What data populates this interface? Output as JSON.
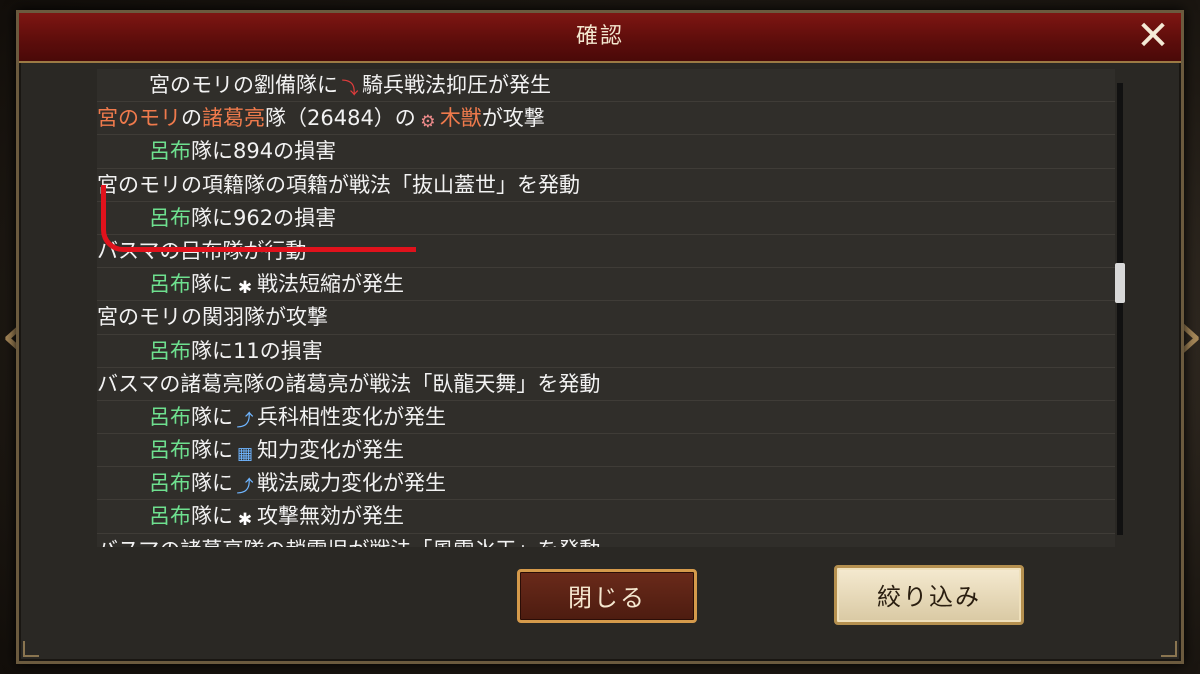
{
  "dialog": {
    "title": "確認",
    "close_glyph": "✕"
  },
  "log": [
    {
      "indent": true,
      "segments": [
        {
          "t": "宮のモリの劉備隊に"
        },
        {
          "icon": "spiral-down-icon",
          "glyph": "⤵",
          "color": "red"
        },
        {
          "t": "騎兵戦法抑圧が発生"
        }
      ]
    },
    {
      "indent": false,
      "segments": [
        {
          "t": "宮のモリ",
          "c": "orange"
        },
        {
          "t": "の"
        },
        {
          "t": "諸葛亮",
          "c": "orange"
        },
        {
          "t": "隊（26484）の"
        },
        {
          "icon": "wooden-beast-icon",
          "glyph": "⚙",
          "color": "pink"
        },
        {
          "t": "木獣",
          "c": "orange"
        },
        {
          "t": "が攻撃"
        }
      ]
    },
    {
      "indent": true,
      "segments": [
        {
          "t": "呂布",
          "c": "green"
        },
        {
          "t": "隊に894の損害"
        }
      ]
    },
    {
      "indent": false,
      "segments": [
        {
          "t": "宮のモリの項籍隊の項籍が戦法「抜山蓋世」を発動"
        }
      ]
    },
    {
      "indent": true,
      "segments": [
        {
          "t": "呂布",
          "c": "green"
        },
        {
          "t": "隊に962の損害"
        }
      ]
    },
    {
      "indent": false,
      "segments": [
        {
          "t": "バスマの呂布隊が行動"
        }
      ]
    },
    {
      "indent": true,
      "segments": [
        {
          "t": "呂布",
          "c": "green"
        },
        {
          "t": "隊に"
        },
        {
          "icon": "tactic-shorten-icon",
          "glyph": "✱",
          "color": "white"
        },
        {
          "t": "戦法短縮が発生"
        }
      ]
    },
    {
      "indent": false,
      "segments": [
        {
          "t": "宮のモリの関羽隊が攻撃"
        }
      ]
    },
    {
      "indent": true,
      "segments": [
        {
          "t": "呂布",
          "c": "green"
        },
        {
          "t": "隊に11の損害"
        }
      ]
    },
    {
      "indent": false,
      "segments": [
        {
          "t": "バスマの諸葛亮隊の諸葛亮が戦法「臥龍天舞」を発動"
        }
      ]
    },
    {
      "indent": true,
      "segments": [
        {
          "t": "呂布",
          "c": "green"
        },
        {
          "t": "隊に"
        },
        {
          "icon": "unit-affinity-up-icon",
          "glyph": "⤴",
          "color": "blue"
        },
        {
          "t": "兵科相性変化が発生"
        }
      ]
    },
    {
      "indent": true,
      "segments": [
        {
          "t": "呂布",
          "c": "green"
        },
        {
          "t": "隊に"
        },
        {
          "icon": "intelligence-up-icon",
          "glyph": "▦",
          "color": "blue"
        },
        {
          "t": "知力変化が発生"
        }
      ]
    },
    {
      "indent": true,
      "segments": [
        {
          "t": "呂布",
          "c": "green"
        },
        {
          "t": "隊に"
        },
        {
          "icon": "tactic-power-up-icon",
          "glyph": "⤴",
          "color": "blue"
        },
        {
          "t": "戦法威力変化が発生"
        }
      ]
    },
    {
      "indent": true,
      "segments": [
        {
          "t": "呂布",
          "c": "green"
        },
        {
          "t": "隊に"
        },
        {
          "icon": "attack-nullify-icon",
          "glyph": "✱",
          "color": "white"
        },
        {
          "t": "攻撃無効が発生"
        }
      ]
    },
    {
      "indent": false,
      "segments": [
        {
          "t": "バスマの諸葛亮隊の趙雲児が戦法「風雪氷天」を発動"
        }
      ]
    }
  ],
  "buttons": {
    "close_label": "閉じる",
    "filter_label": "絞り込み"
  },
  "background": {
    "left_arrow_glyph": "‹",
    "right_arrow_glyph": "›"
  },
  "colors": {
    "title_bar": "#7e1612",
    "highlight_green": "#6ee08f",
    "highlight_orange": "#ef7a4c",
    "annotation_red": "#e0121c"
  }
}
